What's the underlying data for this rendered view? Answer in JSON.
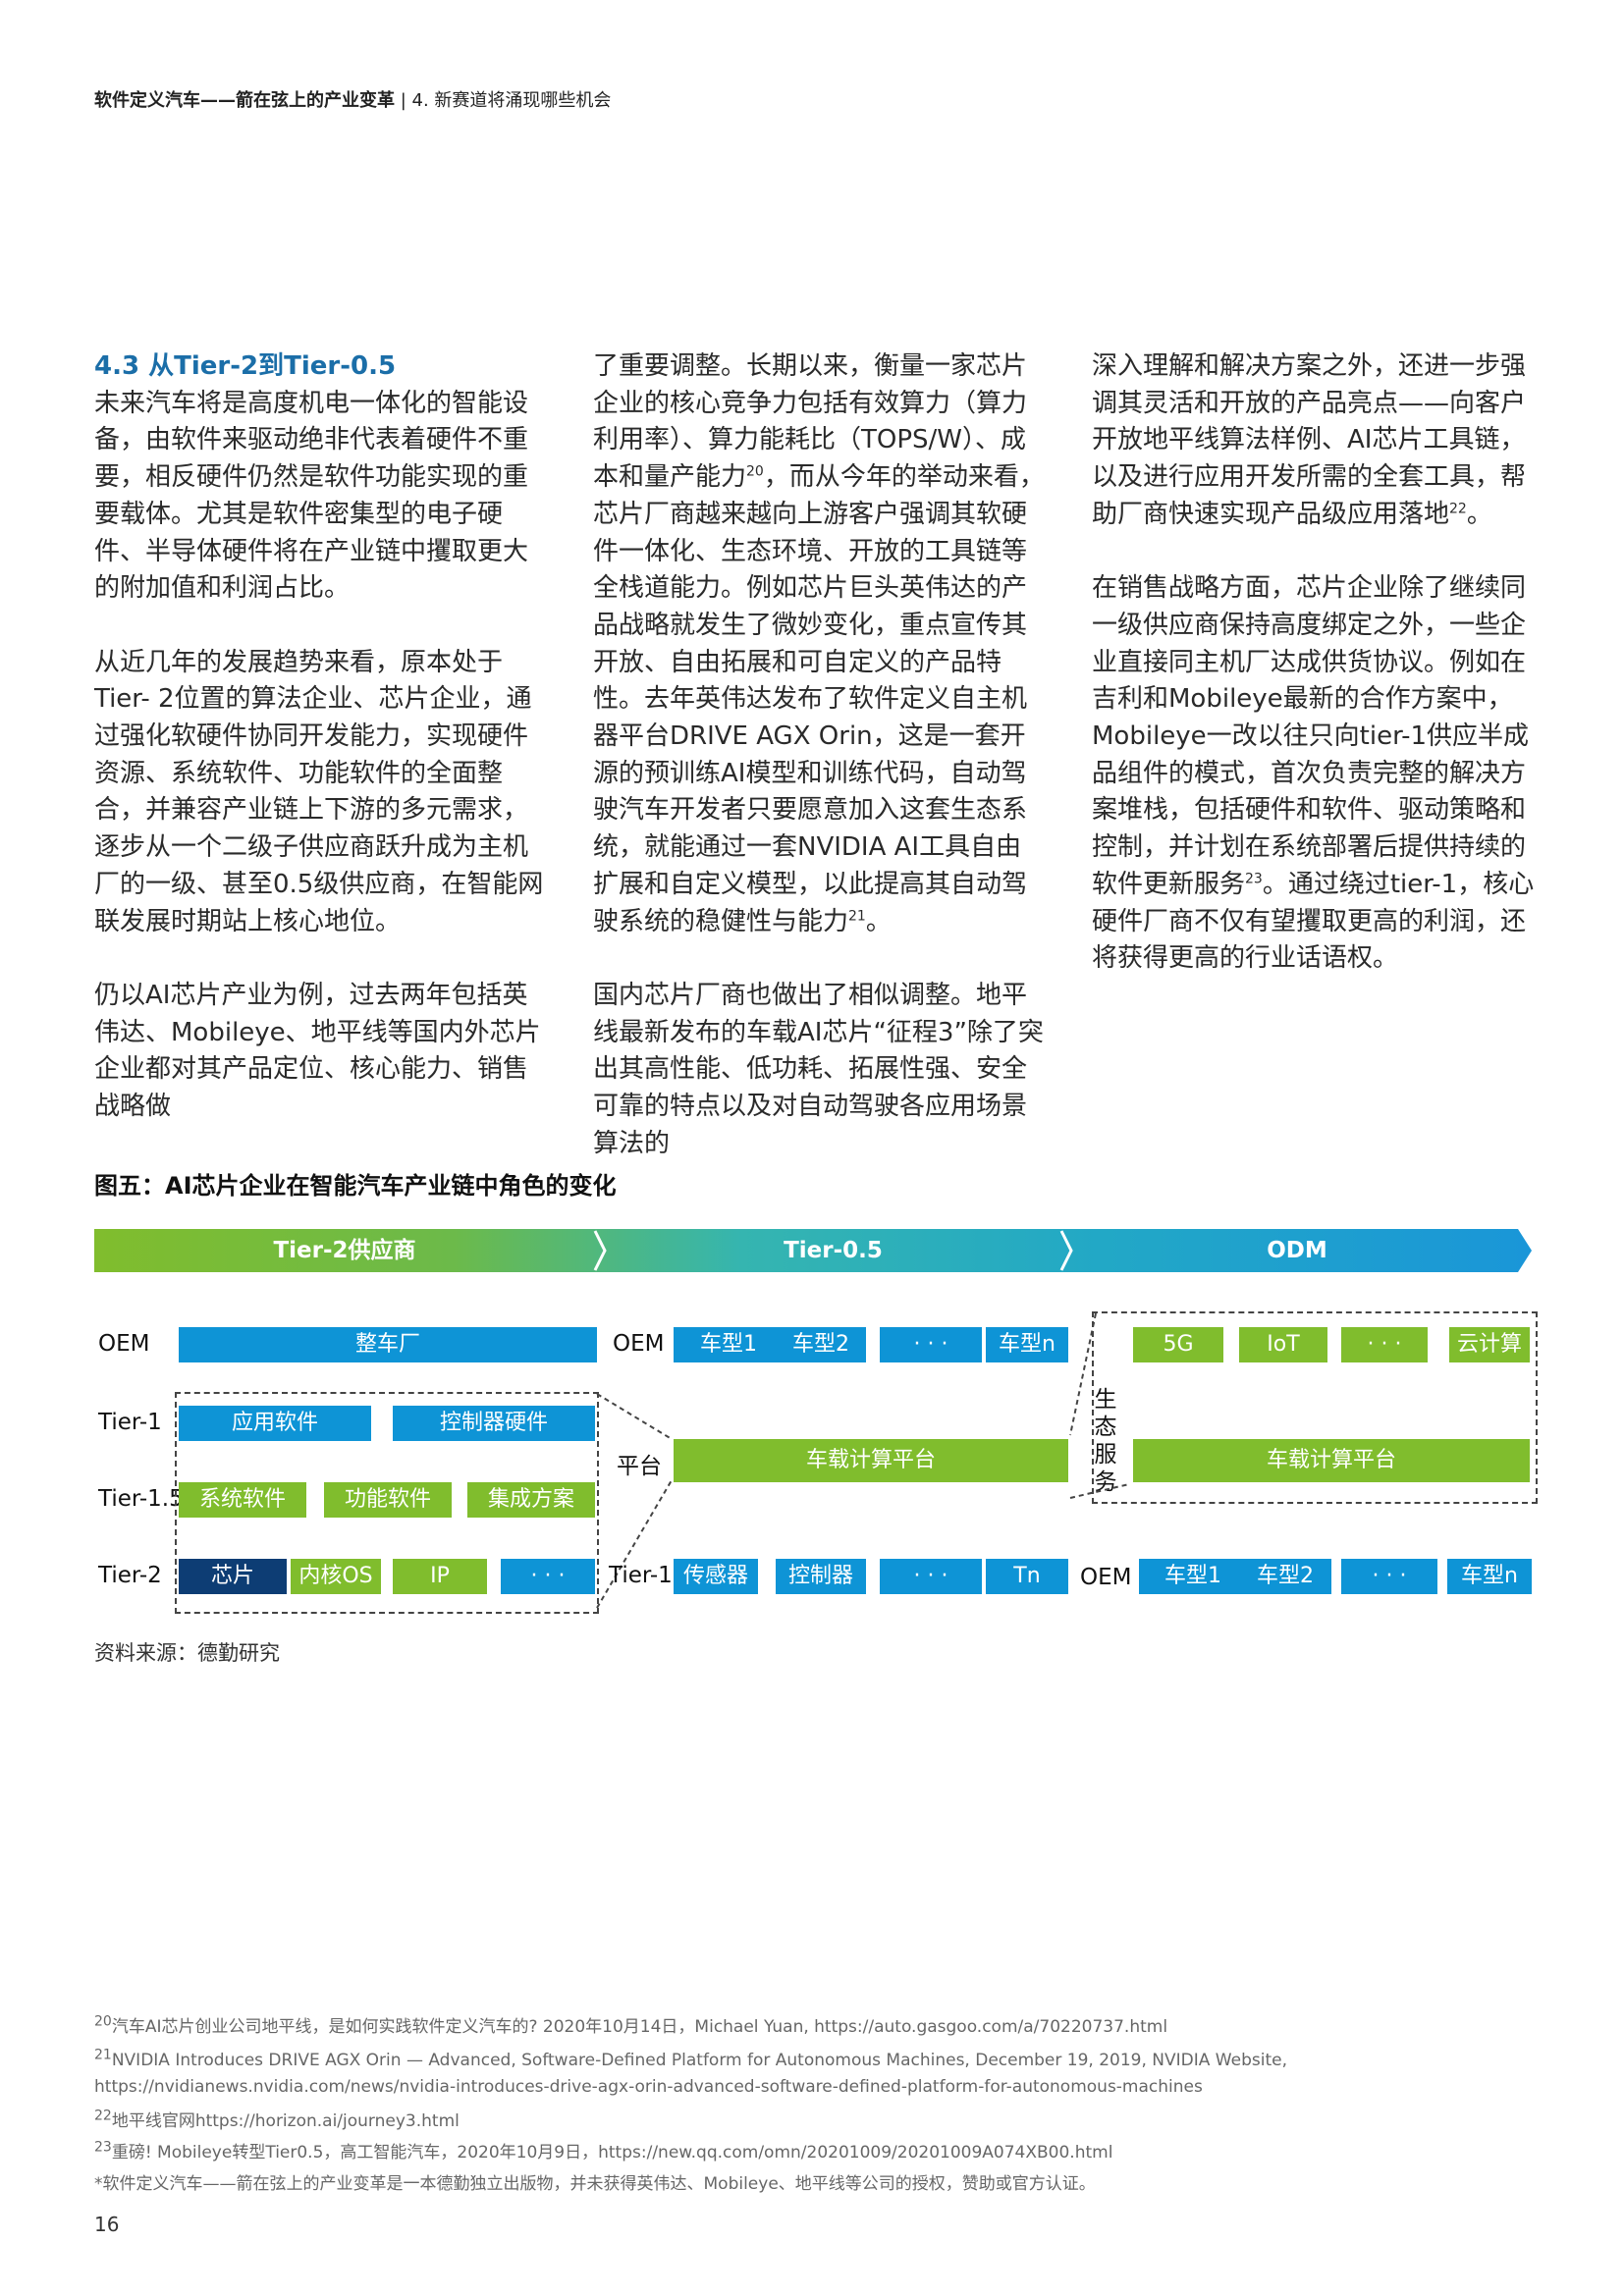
{
  "header": {
    "bold": "软件定义汽车——箭在弦上的产业变革",
    "rest": " | 4. 新赛道将涌现哪些机会"
  },
  "col1": {
    "heading": "4.3 从Tier-2到Tier-0.5",
    "p1": "未来汽车将是高度机电一体化的智能设备，由软件来驱动绝非代表着硬件不重要，相反硬件仍然是软件功能实现的重要载体。尤其是软件密集型的电子硬件、半导体硬件将在产业链中攫取更大的附加值和利润占比。",
    "p2": "从近几年的发展趋势来看，原本处于Tier- 2位置的算法企业、芯片企业，通过强化软硬件协同开发能力，实现硬件资源、系统软件、功能软件的全面整合，并兼容产业链上下游的多元需求，逐步从一个二级子供应商跃升成为主机厂的一级、甚至0.5级供应商，在智能网联发展时期站上核心地位。",
    "p3": "仍以AI芯片产业为例，过去两年包括英伟达、Mobileye、地平线等国内外芯片企业都对其产品定位、核心能力、销售战略做"
  },
  "col2": {
    "p1a": "了重要调整。长期以来，衡量一家芯片企业的核心竞争力包括有效算力（算力利用率）、算力能耗比（TOPS/W）、成本和量产能力",
    "p1sup": "20",
    "p1b": "，而从今年的举动来看，芯片厂商越来越向上游客户强调其软硬件一体化、生态环境、开放的工具链等全栈道能力。例如芯片巨头英伟达的产品战略就发生了微妙变化，重点宣传其开放、自由拓展和可自定义的产品特性。去年英伟达发布了软件定义自主机器平台DRIVE AGX Orin，这是一套开源的预训练AI模型和训练代码，自动驾驶汽车开发者只要愿意加入这套生态系统，就能通过一套NVIDIA AI工具自由扩展和自定义模型，以此提高其自动驾驶系统的稳健性与能力",
    "p1sup2": "21",
    "p1c": "。",
    "p2": "国内芯片厂商也做出了相似调整。地平线最新发布的车载AI芯片“征程3”除了突出其高性能、低功耗、拓展性强、安全可靠的特点以及对自动驾驶各应用场景算法的"
  },
  "col3": {
    "p1a": "深入理解和解决方案之外，还进一步强调其灵活和开放的产品亮点——向客户开放地平线算法样例、AI芯片工具链，以及进行应用开发所需的全套工具，帮助厂商快速实现产品级应用落地",
    "p1sup": "22",
    "p1b": "。",
    "p2a": "在销售战略方面，芯片企业除了继续同一级供应商保持高度绑定之外，一些企业直接同主机厂达成供货协议。例如在吉利和Mobileye最新的合作方案中，Mobileye一改以往只向tier-1供应半成品组件的模式，首次负责完整的解决方案堆栈，包括硬件和软件、驱动策略和控制，并计划在系统部署后提供持续的软件更新服务",
    "p2sup": "23",
    "p2b": "。通过绕过tier-1，核心硬件厂商不仅有望攫取更高的利润，还将获得更高的行业话语权。"
  },
  "figure": {
    "title": "图五：AI芯片企业在智能汽车产业链中角色的变化",
    "stages": [
      "Tier-2供应商",
      "Tier-0.5",
      "ODM"
    ],
    "stage_colors": [
      "#80bd2d",
      "#33b4b4",
      "#1a9ad6"
    ],
    "left": {
      "row_labels": [
        "OEM",
        "Tier-1",
        "Tier-1.5",
        "Tier-2"
      ],
      "oem_box": "整车厂",
      "tier1": [
        "应用软件",
        "控制器硬件"
      ],
      "tier15": [
        "系统软件",
        "功能软件",
        "集成方案"
      ],
      "tier2": [
        "芯片",
        "内核OS",
        "IP",
        "· · ·"
      ]
    },
    "mid": {
      "oem_label": "OEM",
      "oem_boxes": [
        "车型1",
        "车型2",
        "· · ·",
        "车型n"
      ],
      "platform_label": "平台",
      "platform_box": "车载计算平台",
      "tier1_label": "Tier-1",
      "tier1_boxes": [
        "传感器",
        "控制器",
        "· · ·",
        "Tn"
      ]
    },
    "right": {
      "eco_label": "生态服务",
      "top_boxes": [
        "5G",
        "IoT",
        "· · ·",
        "云计算"
      ],
      "platform_box": "车载计算平台",
      "oem_label": "OEM",
      "oem_boxes": [
        "车型1",
        "车型2",
        "· · ·",
        "车型n"
      ]
    },
    "source": "资料来源：德勤研究"
  },
  "footnotes": [
    {
      "num": "20",
      "text": "汽车AI芯片创业公司地平线，是如何实践软件定义汽车的? 2020年10月14日，Michael Yuan, https://auto.gasgoo.com/a/70220737.html"
    },
    {
      "num": "21",
      "text": "NVIDIA Introduces DRIVE AGX Orin — Advanced, Software-Defined Platform for Autonomous Machines, December 19, 2019, NVIDIA Website, https://nvidianews.nvidia.com/news/nvidia-introduces-drive-agx-orin-advanced-software-defined-platform-for-autonomous-machines"
    },
    {
      "num": "22",
      "text": "地平线官网https://horizon.ai/journey3.html"
    },
    {
      "num": "23",
      "text": "重磅! Mobileye转型Tier0.5，高工智能汽车，2020年10月9日，https://new.qq.com/omn/20201009/20201009A074XB00.html"
    }
  ],
  "disclaimer": "*软件定义汽车——箭在弦上的产业变革是一本德勤独立出版物，并未获得英伟达、Mobileye、地平线等公司的授权，赞助或官方认证。",
  "page_number": "16"
}
